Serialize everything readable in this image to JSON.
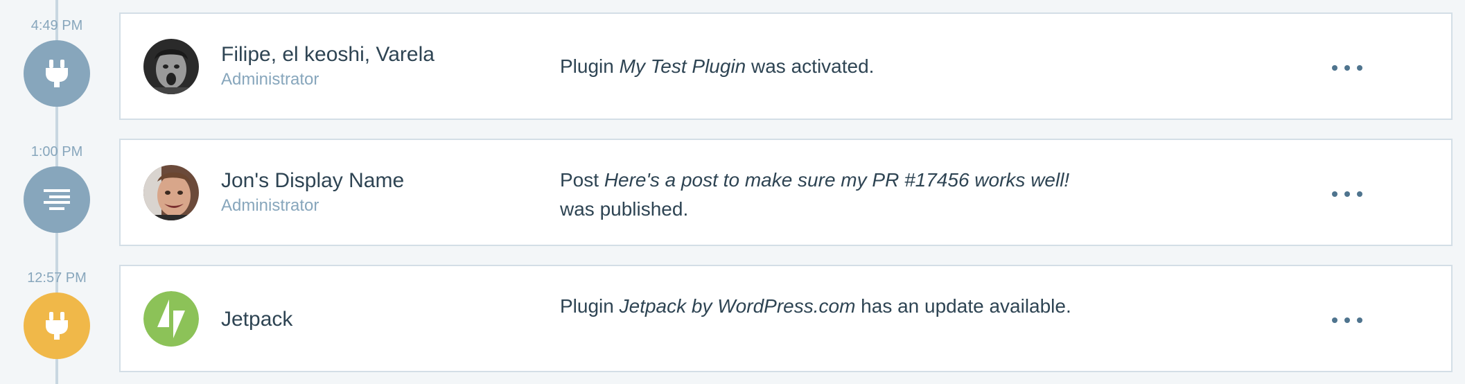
{
  "events": [
    {
      "time": "4:49 PM",
      "icon": "plugin-icon",
      "bubble_color": "#87a6bc",
      "actor": {
        "name": "Filipe, el keoshi, Varela",
        "role": "Administrator"
      },
      "description": {
        "prefix": "Plugin ",
        "target": "My Test Plugin",
        "suffix": " was activated."
      },
      "more_label": "More actions"
    },
    {
      "time": "1:00 PM",
      "icon": "post-icon",
      "bubble_color": "#87a6bc",
      "actor": {
        "name": "Jon's Display Name",
        "role": "Administrator"
      },
      "description": {
        "prefix": "Post ",
        "target": "Here's a post to make sure my PR #17456 works well!",
        "suffix": " was published."
      },
      "more_label": "More actions"
    },
    {
      "time": "12:57 PM",
      "icon": "plugin-icon",
      "bubble_color": "#f0b849",
      "actor": {
        "name": "Jetpack",
        "role": ""
      },
      "description": {
        "prefix": "Plugin ",
        "target": "Jetpack by WordPress.com",
        "suffix": " has an update available."
      },
      "more_label": "More actions"
    }
  ],
  "colors": {
    "timeline": "#c8d7e1",
    "text_primary": "#2e4453",
    "text_secondary": "#87a6bc",
    "jetpack_green": "#8cc258"
  }
}
